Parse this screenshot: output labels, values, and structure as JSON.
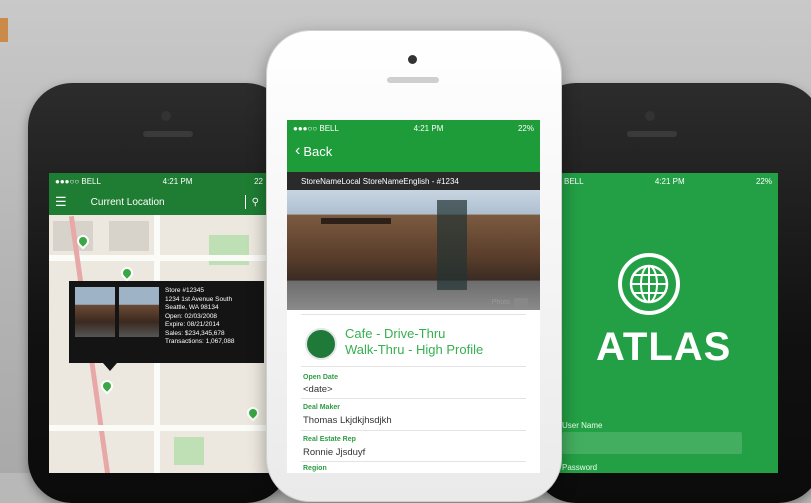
{
  "left_phone": {
    "status": {
      "carrier": "●●●○○ BELL",
      "time": "4:21 PM",
      "battery": "22"
    },
    "header": {
      "title": "Current Location"
    },
    "callout": {
      "lines": [
        "Store #12345",
        "1234 1st Avenue South",
        "Seattle, WA 98134",
        "Open: 02/03/2008",
        "Expire: 08/21/2014",
        "Sales: $234,345,678",
        "Transactions: 1,067,088"
      ]
    }
  },
  "center_phone": {
    "status": {
      "carrier": "●●●○○ BELL",
      "time": "4:21 PM",
      "battery": "22%"
    },
    "back_label": "Back",
    "store_bar": "StoreNameLocal StoreNameEnglish - #1234",
    "photo_label": "Photo",
    "store_type_line1": "Cafe - Drive-Thru",
    "store_type_line2": "Walk-Thru - High Profile",
    "fields": [
      {
        "label": "Open Date",
        "value": "<date>"
      },
      {
        "label": "Deal Maker",
        "value": "Thomas Lkjdkjhsdjkh"
      },
      {
        "label": "Real Estate Rep",
        "value": "Ronnie Jjsduyf"
      },
      {
        "label": "Region",
        "value": ""
      }
    ]
  },
  "right_phone": {
    "status": {
      "carrier": "BELL",
      "time": "4:21 PM",
      "battery": "22%"
    },
    "app_name": "ATLAS",
    "username_label": "User Name",
    "password_label": "Password"
  },
  "colors": {
    "green": "#1e9c3a",
    "dark_green": "#1e7d33",
    "accent_text": "#36b04f"
  }
}
